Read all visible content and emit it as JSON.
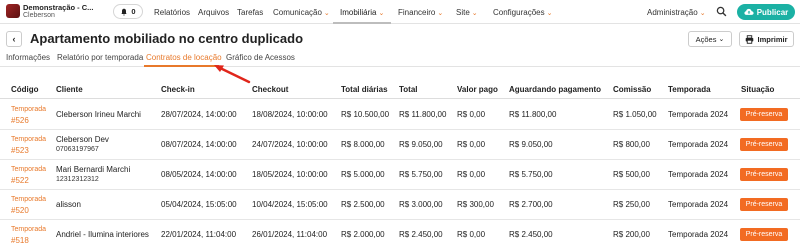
{
  "topbar": {
    "brand_title": "Demonstração - C...",
    "brand_subtitle": "Cleberson",
    "notifications_count": "0",
    "nav": [
      {
        "label": "Relatórios",
        "dropdown": false
      },
      {
        "label": "Arquivos",
        "dropdown": false
      },
      {
        "label": "Tarefas",
        "dropdown": false
      },
      {
        "label": "Comunicação",
        "dropdown": true
      },
      {
        "label": "Imobiliária",
        "dropdown": true,
        "active": true
      },
      {
        "label": "Financeiro",
        "dropdown": true
      },
      {
        "label": "Site",
        "dropdown": true
      },
      {
        "label": "Configurações",
        "dropdown": true
      }
    ],
    "admin_label": "Administração",
    "publish_label": "Publicar"
  },
  "header": {
    "title": "Apartamento mobiliado no centro duplicado",
    "actions_label": "Ações",
    "print_label": "Imprimir"
  },
  "tabs": [
    {
      "label": "Informações"
    },
    {
      "label": "Relatório por temporada"
    },
    {
      "label": "Contratos de locação",
      "active": true
    },
    {
      "label": "Gráfico de Acessos"
    }
  ],
  "table": {
    "columns": [
      "Código",
      "Cliente",
      "Check-in",
      "Checkout",
      "Total diárias",
      "Total",
      "Valor pago",
      "Aguardando pagamento",
      "Comissão",
      "Temporada",
      "Situação"
    ],
    "rows": [
      {
        "code_type": "Temporada",
        "code_num": "#526",
        "client": "Cleberson Irineu Marchi",
        "client_sub": "",
        "checkin": "28/07/2024, 14:00:00",
        "checkout": "18/08/2024, 10:00:00",
        "total_diarias": "R$ 10.500,00",
        "total": "R$ 11.800,00",
        "valor_pago": "R$ 0,00",
        "aguardando": "R$ 11.800,00",
        "comissao": "R$ 1.050,00",
        "temporada": "Temporada 2024",
        "situacao": "Pré-reserva"
      },
      {
        "code_type": "Temporada",
        "code_num": "#523",
        "client": "Cleberson Dev",
        "client_sub": "07063197967",
        "checkin": "08/07/2024, 14:00:00",
        "checkout": "24/07/2024, 10:00:00",
        "total_diarias": "R$ 8.000,00",
        "total": "R$ 9.050,00",
        "valor_pago": "R$ 0,00",
        "aguardando": "R$ 9.050,00",
        "comissao": "R$ 800,00",
        "temporada": "Temporada 2024",
        "situacao": "Pré-reserva"
      },
      {
        "code_type": "Temporada",
        "code_num": "#522",
        "client": "Mari Bernardi Marchi",
        "client_sub": "12312312312",
        "checkin": "08/05/2024, 14:00:00",
        "checkout": "18/05/2024, 10:00:00",
        "total_diarias": "R$ 5.000,00",
        "total": "R$ 5.750,00",
        "valor_pago": "R$ 0,00",
        "aguardando": "R$ 5.750,00",
        "comissao": "R$ 500,00",
        "temporada": "Temporada 2024",
        "situacao": "Pré-reserva"
      },
      {
        "code_type": "Temporada",
        "code_num": "#520",
        "client": "alisson",
        "client_sub": "",
        "checkin": "05/04/2024, 15:05:00",
        "checkout": "10/04/2024, 15:05:00",
        "total_diarias": "R$ 2.500,00",
        "total": "R$ 3.000,00",
        "valor_pago": "R$ 300,00",
        "aguardando": "R$ 2.700,00",
        "comissao": "R$ 250,00",
        "temporada": "Temporada 2024",
        "situacao": "Pré-reserva"
      },
      {
        "code_type": "Temporada",
        "code_num": "#518",
        "client": "Andriel - Ilumina interiores",
        "client_sub": "",
        "checkin": "22/01/2024, 11:04:00",
        "checkout": "26/01/2024, 11:04:00",
        "total_diarias": "R$ 2.000,00",
        "total": "R$ 2.450,00",
        "valor_pago": "R$ 0,00",
        "aguardando": "R$ 2.450,00",
        "comissao": "R$ 200,00",
        "temporada": "Temporada 2024",
        "situacao": "Pré-reserva"
      }
    ]
  },
  "colors": {
    "accent": "#e8792b",
    "badge": "#f26b22",
    "publish": "#1bb1a4",
    "annotation_arrow": "#e0261b"
  }
}
